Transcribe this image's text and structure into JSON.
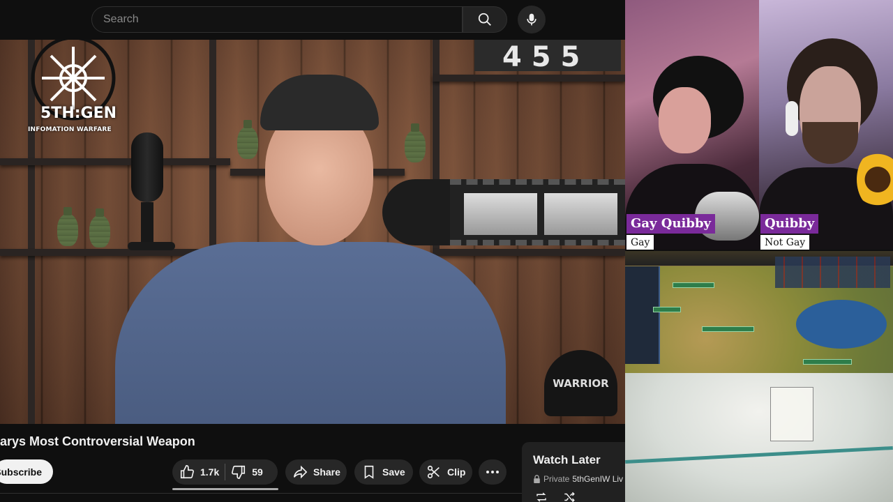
{
  "search": {
    "placeholder": "Search"
  },
  "channel_logo": {
    "name": "5TH:GEN",
    "tagline": "INFOMATION WARFARE"
  },
  "video": {
    "title": "arys Most Controversial Weapon",
    "set_text": {
      "flip_clock": "4 5 5",
      "cap_text": "WARRIOR"
    }
  },
  "actions": {
    "subscribe": "Subscribe",
    "likes": "1.7k",
    "dislikes": "59",
    "share": "Share",
    "save": "Save",
    "clip": "Clip"
  },
  "watch_later": {
    "title": "Watch Later",
    "privacy": "Private",
    "owner": "5thGenIW Liv"
  },
  "stream": {
    "cam1": {
      "name": "Gay Quibby",
      "sub": "Gay"
    },
    "cam2": {
      "name": "Quibby",
      "sub": "Not Gay"
    }
  },
  "colors": {
    "bg": "#0f0f0f",
    "pill": "#272727",
    "name_tag": "#7a2a9a"
  },
  "icons": [
    "search-icon",
    "mic-icon",
    "like-icon",
    "dislike-icon",
    "share-icon",
    "save-icon",
    "clip-icon",
    "more-icon",
    "lock-icon",
    "loop-icon",
    "shuffle-icon"
  ]
}
